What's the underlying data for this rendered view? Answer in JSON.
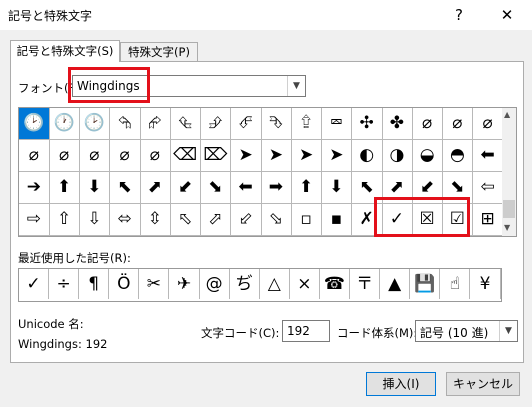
{
  "window": {
    "title": "記号と特殊文字",
    "help": "?",
    "close": "✕"
  },
  "tabs": [
    {
      "label": "記号と特殊文字(S)"
    },
    {
      "label": "特殊文字(P)"
    }
  ],
  "font_label": "フォント(F):",
  "font_value": "Wingdings",
  "grid_rows": [
    [
      "🕑",
      "🕐",
      "🕑",
      "⮲",
      "⮳",
      "⮴",
      "⮵",
      "⮶",
      "⮷",
      "⮸",
      "⮹",
      "✣",
      "✤",
      "⌀",
      "⌀",
      "⌀"
    ],
    [
      "⌀",
      "⌀",
      "⌀",
      "⌀",
      "⌀",
      "⌫",
      "⌦",
      "➤",
      "➤",
      "➤",
      "➤",
      "◐",
      "◑",
      "◒",
      "◓",
      "⬅"
    ],
    [
      "➔",
      "⬆",
      "⬇",
      "⬉",
      "⬈",
      "⬋",
      "⬊",
      "⬅",
      "➡",
      "⬆",
      "⬇",
      "⬉",
      "⬈",
      "⬋",
      "⬊",
      "⇦"
    ],
    [
      "⇨",
      "⇧",
      "⇩",
      "⬄",
      "⇳",
      "⬁",
      "⬀",
      "⬃",
      "⬂",
      "▫",
      "▪",
      "✗",
      "✓",
      "☒",
      "☑",
      "⊞"
    ]
  ],
  "recent_label": "最近使用した記号(R):",
  "recent": [
    "✓",
    "÷",
    "¶",
    "Ö",
    "✂",
    "✈",
    "@",
    "ぢ",
    "△",
    "×",
    "☎",
    "〒",
    "▲",
    "💾",
    "☝",
    "¥"
  ],
  "unicode_label": "Unicode 名:",
  "unicode_value": "Wingdings: 192",
  "charcode_label": "文字コード(C):",
  "charcode_value": "192",
  "codetype_label": "コード体系(M):",
  "codetype_value": "記号 (10 進)",
  "insert_button": "挿入(I)",
  "cancel_button": "キャンセル"
}
